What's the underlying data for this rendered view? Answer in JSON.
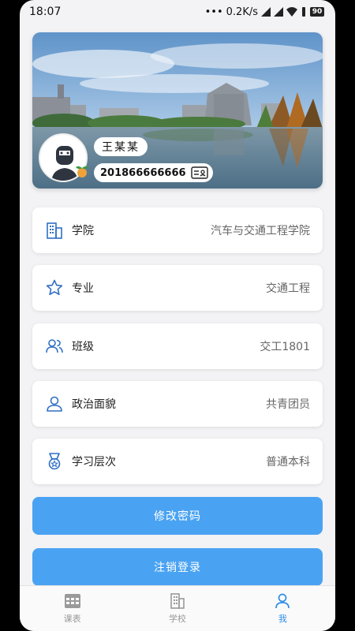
{
  "status_bar": {
    "time": "18:07",
    "network_speed": "0.2K/s",
    "battery": "90"
  },
  "profile": {
    "name": "王某某",
    "student_id": "201866666666"
  },
  "info_items": [
    {
      "label": "学院",
      "value": "汽车与交通工程学院",
      "icon": "building-icon"
    },
    {
      "label": "专业",
      "value": "交通工程",
      "icon": "star-icon"
    },
    {
      "label": "班级",
      "value": "交工1801",
      "icon": "users-icon"
    },
    {
      "label": "政治面貌",
      "value": "共青团员",
      "icon": "person-icon"
    },
    {
      "label": "学习层次",
      "value": "普通本科",
      "icon": "medal-icon"
    }
  ],
  "actions": {
    "change_password": "修改密码",
    "logout": "注销登录"
  },
  "tabbar": {
    "items": [
      {
        "label": "课表",
        "icon": "timetable-icon"
      },
      {
        "label": "学校",
        "icon": "school-icon"
      },
      {
        "label": "我",
        "icon": "profile-icon"
      }
    ],
    "active_index": 2
  },
  "colors": {
    "accent": "#4aa3f2",
    "tab_active": "#2f8de4",
    "icon": "#2f6fc4"
  }
}
